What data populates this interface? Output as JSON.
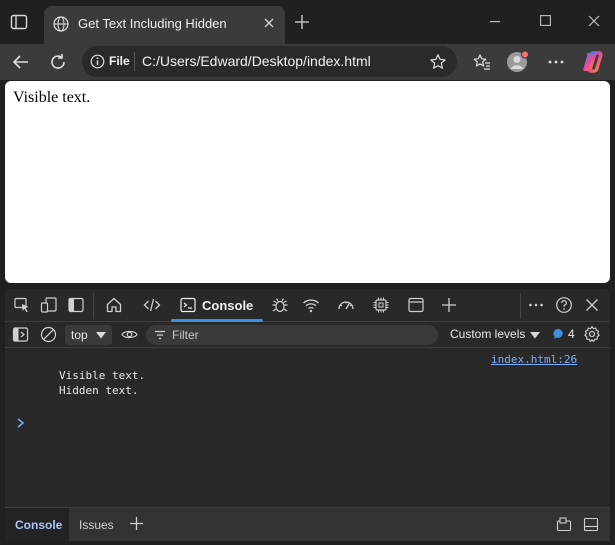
{
  "window": {
    "tab_title": "Get Text Including Hidden",
    "tab_icon": "globe-icon",
    "controls": [
      "minimize-icon",
      "maximize-icon",
      "close-icon"
    ]
  },
  "toolbar": {
    "scheme_label": "File",
    "url": "C:/Users/Edward/Desktop/index.html",
    "icons": [
      "back-arrow-icon",
      "refresh-icon",
      "info-icon",
      "favorite-star-icon",
      "favorites-icon",
      "profile-avatar-icon",
      "more-icon",
      "copilot-icon"
    ]
  },
  "page": {
    "body_text": "Visible text."
  },
  "devtools": {
    "tabs": {
      "icons": [
        "inspect-element-icon",
        "device-emulation-icon",
        "sidebar-toggle-icon",
        "welcome-home-icon",
        "elements-code-icon",
        "console-icon",
        "sources-bug-icon",
        "network-wifi-icon",
        "performance-gauge-icon",
        "memory-chip-icon",
        "application-panel-icon",
        "add-tool-icon",
        "more-tools-icon",
        "help-icon",
        "close-devtools-icon"
      ],
      "active_label": "Console"
    },
    "filterbar": {
      "context_value": "top",
      "filter_placeholder": "Filter",
      "levels_label": "Custom levels",
      "issues_count": "4"
    },
    "console": {
      "source_link": "index.html:26",
      "log_lines": [
        "Visible text.",
        "Hidden text."
      ]
    },
    "drawer": {
      "tabs": [
        "Console",
        "Issues"
      ]
    }
  },
  "colors": {
    "accent": "#3d8ee8",
    "link": "#7cacf8",
    "copilot_gradient": [
      "#3b82f6",
      "#ec4899",
      "#f59e0b"
    ],
    "avatar_badge": "#f87171"
  }
}
